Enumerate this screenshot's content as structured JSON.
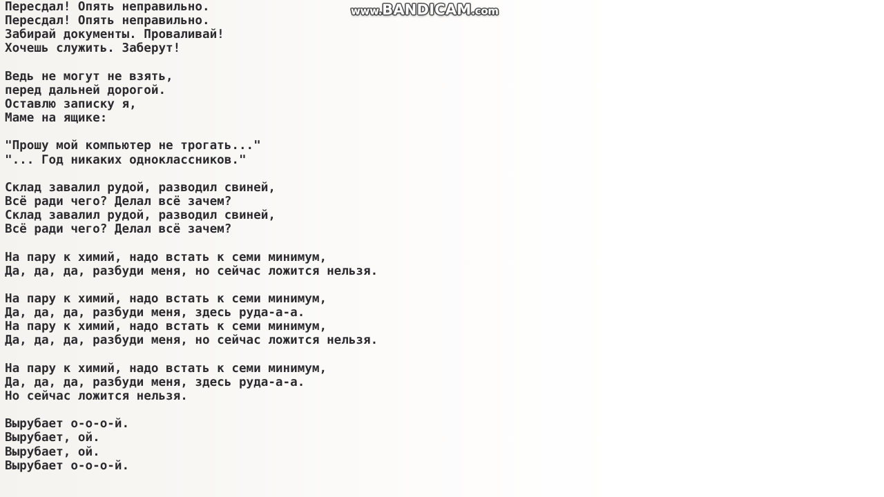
{
  "window": {
    "background_color": "#ffffff",
    "text_color": "#2b2b2f"
  },
  "watermark": {
    "prefix": "www.",
    "brand": "BANDICAM",
    "suffix": ".com",
    "full_text": "www.BANDICAM.com",
    "color": "#ffffff",
    "outline_color": "#4a4a4a"
  },
  "lyrics": {
    "lines": [
      "Пересдал! Опять неправильно.",
      "Пересдал! Опять неправильно.",
      "Забирай документы. Проваливай!",
      "Хочешь служить. Заберут!",
      "",
      "Ведь не могут не взять,",
      "перед дальней дорогой.",
      "Оставлю записку я,",
      "Маме на ящике:",
      "",
      "\"Прошу мой компьютер не трогать...\"",
      "\"... Год никаких одноклассников.\"",
      "",
      "Склад завалил рудой, разводил свиней,",
      "Всё ради чего? Делал всё зачем?",
      "Склад завалил рудой, разводил свиней,",
      "Всё ради чего? Делал всё зачем?",
      "",
      "На пару к химий, надо встать к семи минимум,",
      "Да, да, да, разбуди меня, но сейчас ложится нельзя.",
      "",
      "На пару к химий, надо встать к семи минимум,",
      "Да, да, да, разбуди меня, здесь руда-а-а.",
      "На пару к химий, надо встать к семи минимум,",
      "Да, да, да, разбуди меня, но сейчас ложится нельзя.",
      "",
      "На пару к химий, надо встать к семи минимум,",
      "Да, да, да, разбуди меня, здесь руда-а-а.",
      "Но сейчас ложится нельзя.",
      "",
      "Вырубает о-о-о-й.",
      "Вырубает, ой.",
      "Вырубает, ой.",
      "Вырубает о-о-о-й."
    ]
  }
}
